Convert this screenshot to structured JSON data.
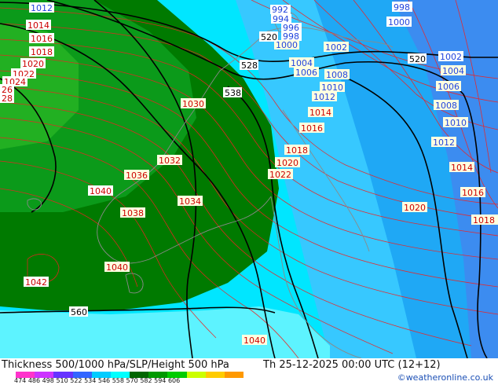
{
  "map": {
    "title": "Thickness 500/1000 hPa/SLP/Height 500 hPa",
    "valid": "Th 25-12-2025 00:00 UTC (12+12)",
    "credit": "©weatheronline.co.uk",
    "colorbar": {
      "ticks": "474 486 498 510 522 534 546 558 570 582 594 606",
      "colors": [
        "#ff33cc",
        "#cc33ff",
        "#6633ff",
        "#3366ff",
        "#00ccff",
        "#00ffff",
        "#006600",
        "#009900",
        "#00cc00",
        "#ccff00",
        "#ffcc00",
        "#ff9900"
      ]
    },
    "slp_labels_left": [
      "1012",
      "1014",
      "1016",
      "1018",
      "1020",
      "1022",
      "1024",
      "26",
      "28",
      "1030",
      "1032",
      "1036",
      "1038",
      "1040",
      "1042",
      "1040",
      "1034",
      "1040"
    ],
    "slp_labels_top": [
      "992",
      "994",
      "996",
      "998",
      "1000",
      "1002",
      "1004",
      "1006",
      "1008",
      "1010",
      "1012",
      "1014",
      "1016",
      "1018",
      "1020",
      "1022"
    ],
    "slp_labels_right": [
      "998",
      "1000",
      "1002",
      "1004",
      "1006",
      "1008",
      "1010",
      "1012",
      "1014",
      "1016",
      "1018",
      "1020"
    ],
    "height_labels": [
      "520",
      "528",
      "538",
      "520",
      "560"
    ]
  }
}
